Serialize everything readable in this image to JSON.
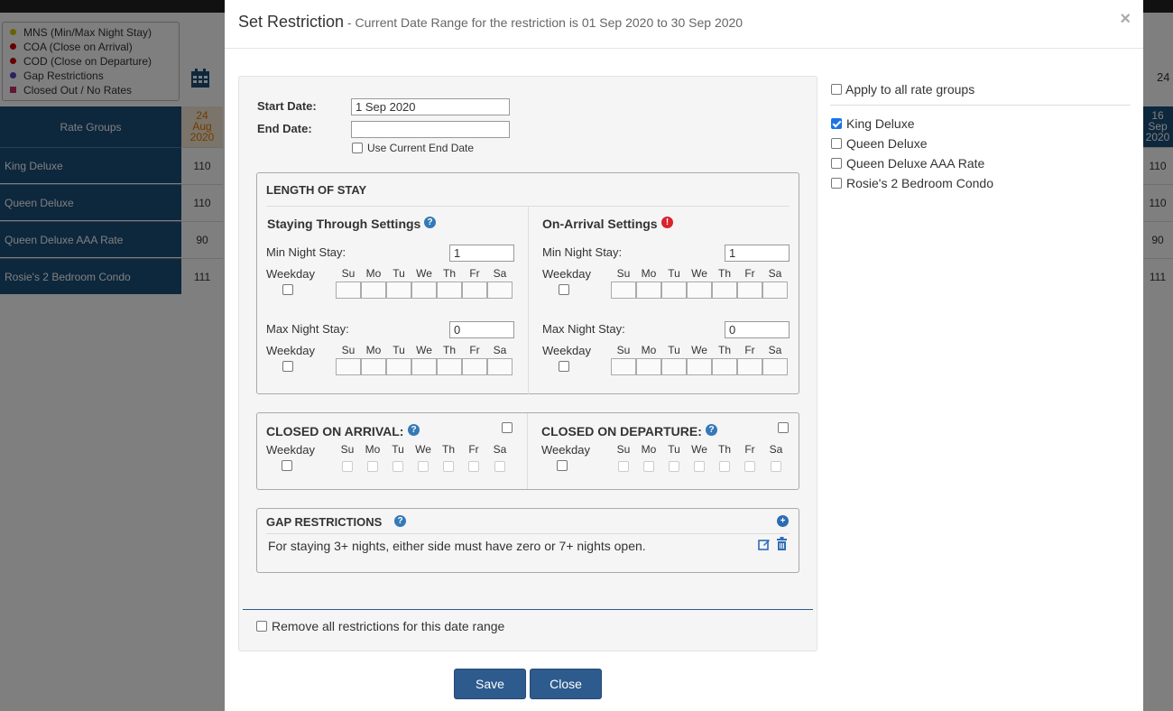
{
  "background": {
    "legend": [
      {
        "label": "MNS (Min/Max Night Stay)",
        "color": "#d4c400",
        "shape": "dot"
      },
      {
        "label": "COA (Close on Arrival)",
        "color": "#cc0000",
        "shape": "dot"
      },
      {
        "label": "COD (Close on Departure)",
        "color": "#cc0000",
        "shape": "dot"
      },
      {
        "label": "Gap Restrictions",
        "color": "#5a3fc0",
        "shape": "dot"
      },
      {
        "label": "Closed Out / No Rates",
        "color": "#c0306a",
        "shape": "square"
      }
    ],
    "grid_header": "Rate Groups",
    "date_left": {
      "day": "24",
      "month": "Aug",
      "year": "2020"
    },
    "date_right": {
      "day": "16",
      "month": "Sep",
      "year": "2020"
    },
    "top_right_number": "24",
    "rows": [
      {
        "name": "King Deluxe",
        "left": "110",
        "right": "110"
      },
      {
        "name": "Queen Deluxe",
        "left": "110",
        "right": "110"
      },
      {
        "name": "Queen Deluxe AAA Rate",
        "left": "90",
        "right": "90"
      },
      {
        "name": "Rosie's 2 Bedroom Condo",
        "left": "111",
        "right": "111"
      }
    ]
  },
  "modal": {
    "title": "Set Restriction",
    "subtitle": " - Current Date Range for the restriction is 01 Sep 2020 to 30 Sep 2020",
    "close_symbol": "×",
    "start_date_label": "Start Date:",
    "start_date_value": "1 Sep 2020",
    "end_date_label": "End Date:",
    "end_date_value": "",
    "use_current_end_date": "Use Current End Date",
    "length_of_stay": {
      "heading": "LENGTH OF STAY",
      "staying_through": "Staying Through Settings",
      "on_arrival": "On-Arrival Settings",
      "min_night_stay": "Min Night Stay:",
      "max_night_stay": "Max Night Stay:",
      "weekday": "Weekday",
      "st_min_value": "1",
      "st_max_value": "0",
      "oa_min_value": "1",
      "oa_max_value": "0"
    },
    "days": [
      "Su",
      "Mo",
      "Tu",
      "We",
      "Th",
      "Fr",
      "Sa"
    ],
    "closed_on_arrival": "CLOSED ON ARRIVAL:",
    "closed_on_departure": "CLOSED ON DEPARTURE:",
    "gap_restrictions": {
      "heading": "GAP RESTRICTIONS",
      "rule": "For staying 3+ nights, either side must have zero or 7+ nights open."
    },
    "remove_all": "Remove all restrictions for this date range",
    "save_button": "Save",
    "close_button": "Close",
    "apply_all": "Apply to all rate groups",
    "rate_groups": [
      {
        "label": "King Deluxe",
        "checked": true
      },
      {
        "label": "Queen Deluxe",
        "checked": false
      },
      {
        "label": "Queen Deluxe AAA Rate",
        "checked": false
      },
      {
        "label": "Rosie's 2 Bedroom Condo",
        "checked": false
      }
    ]
  }
}
